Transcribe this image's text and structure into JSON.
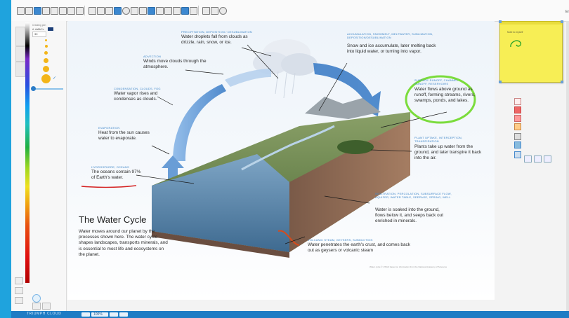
{
  "app": {
    "brand": "TRIUMPH CLOUD",
    "zoom": "100%",
    "lang_label": "En"
  },
  "left_panel": {
    "tool_name": "Creating pen",
    "sample_label": "A. AaBbCc",
    "size_value": "30"
  },
  "sticky_note": {
    "title": "Note to myself",
    "color": "#f7ee55"
  },
  "poster": {
    "title": "The Water Cycle",
    "description": "Water moves around our planet by the processes shown here. The water cycle shapes landscapes, transports minerals, and is essential to most life and ecosystems on the planet.",
    "footer": "Water cycle © USGS based on information from the National Academy of Sciences",
    "captions": {
      "precipitation": {
        "cap": "PRECIPITATION, DEPOSITION / DESUBLIMATION",
        "text": "Water droplets fall from clouds as drizzle, rain, snow, or ice."
      },
      "accumulation": {
        "cap": "ACCUMULATION, SNOWMELT, MELTWATER, SUBLIMATION, DEPOSITION/DESUBLIMATION",
        "text": "Snow and ice accumulate, later melting back into liquid water, or turning into vapor."
      },
      "advection": {
        "cap": "ADVECTION",
        "text": "Winds move clouds through the atmosphere."
      },
      "condensation": {
        "cap": "CONDENSATION, CLOUDS, FOG",
        "text": "Water vapor rises and condenses as clouds."
      },
      "runoff": {
        "cap": "SURFACE RUNOFF, CHANNEL RUNOFF, RESERVOIRS",
        "text": "Water flows above ground as runoff, forming streams, rivers, swamps, ponds, and lakes."
      },
      "evaporation": {
        "cap": "EVAPORATION",
        "text": "Heat from the sun causes water to evaporate."
      },
      "plant": {
        "cap": "PLANT UPTAKE, INTERCEPTION, TRANSPIRATION",
        "text": "Plants take up water from the ground, and later transpire it back into the air."
      },
      "oceans": {
        "cap": "HYDROSPHERE, OCEANS",
        "text": "The oceans contain 97% of Earth's water."
      },
      "infiltration": {
        "cap": "INFILTRATION, PERCOLATION, SUBSURFACE FLOW, AQUIFER, WATER TABLE, SEEPAGE, SPRING, WELL",
        "text": "Water is soaked into the ground, flows below it, and seeps back out enriched in minerals."
      },
      "volcanic": {
        "cap": "VOLCANIC STEAM, GEYSERS, SUBDUCTION",
        "text": "Water penetrates the earth's crust, and comes back out as geysers or volcanic steam"
      }
    }
  },
  "colors": {
    "accent_blue": "#1fa3dd",
    "annotation_green": "#7bdc3c",
    "annotation_red": "#d42020",
    "arrow_blue": "#3f86c8"
  }
}
